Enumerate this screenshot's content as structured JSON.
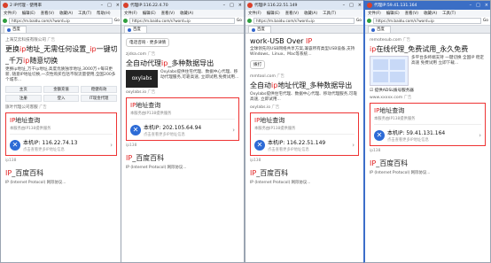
{
  "windows": [
    {
      "title": "2 IP代理 - 使用率",
      "menu": [
        "文件(F)",
        "编辑(E)",
        "查看(V)",
        "收藏(A)",
        "工具(T)",
        "帮助(H)"
      ],
      "address": "https://m.baidu.com/s?word=ip",
      "go": "Go",
      "tab": "百度",
      "lines": [
        {
          "type": "url",
          "text": "上海艾云科技有限公司",
          "badge": "广告"
        },
        {
          "type": "head",
          "pre": "更换",
          "red": "ip",
          "post": "地址_无需任何设置_",
          "red2": "ip",
          "post2": "一键切换"
        },
        {
          "type": "head2",
          "pre": "_千万",
          "red": "ip",
          "post": "随意切换"
        },
        {
          "type": "text",
          "text": "更换ip地址_万千ip地址,高度优质独享地址,3000万+每日更新, 随意IP地址切换,一次性购买包括不限流量使用,全国200多个城市..."
        },
        {
          "type": "buttons",
          "items": [
            "主页",
            "金额充值",
            "稳健有效",
            "注册",
            "登入",
            "IT现金代理"
          ]
        },
        {
          "type": "url",
          "text": "旗叶代理公司客服",
          "badge": "广告"
        }
      ],
      "box": {
        "title_red": "IP",
        "title": "地址查询",
        "sub": "本服务由IP138提供服务",
        "ip_label": "本机IP: ",
        "ip": "116.22.74.13",
        "ip_sub": "点击查看更多IP地址信息"
      },
      "foot": "ip138",
      "big_red": "IP",
      "big": "_百度百科",
      "mini": "IP (Internet Protocol) 网际协议..."
    },
    {
      "title": "代理IP:116.22.4.70",
      "menu": [
        "文件(F)",
        "编辑(E)",
        "查看(V)",
        "收藏(A)"
      ],
      "address": "https://m.baidu.com/s?word=ip",
      "go": "Go",
      "tab": "百度",
      "lines": [
        {
          "type": "pill",
          "text": "电话咨询 · 更多详情"
        },
        {
          "type": "url",
          "text": "zjdsa.com",
          "badge": "广告"
        },
        {
          "type": "head",
          "pre": "全自动代理",
          "red": "ip",
          "post": "_多种数据导出"
        },
        {
          "type": "logo",
          "logo": "oxylabs",
          "text": "Oxylabs提供住宅代理、数据中心代理、移动代理服务,可靠高速, 立即试用,免费试用..."
        },
        {
          "type": "url",
          "text": "oxylabs.io",
          "badge": "广告"
        }
      ],
      "box": {
        "title_red": "IP",
        "title": "地址查询",
        "sub": "本服务由IP138提供服务",
        "ip_label": "本机IP: ",
        "ip": "202.105.64.94",
        "ip_sub": "点击查看更多IP地址信息"
      },
      "foot": "ip138",
      "big_red": "IP",
      "big": "_百度百科",
      "mini": "IP (Internet Protocol) 网际协议..."
    },
    {
      "title": "代理IP:116.22.51.149",
      "menu": [
        "文件(F)",
        "编辑(E)",
        "查看(V)",
        "收藏(A)",
        "工具(T)"
      ],
      "address": "https://m.baidu.com/s?word=ip",
      "go": "Go",
      "tab": "百度",
      "lines": [
        {
          "type": "head",
          "pre": "work-USB Over ",
          "red": "IP",
          "post": ""
        },
        {
          "type": "text",
          "text": "全球领先的USB网络共享方案,兼容所有类型USB设备,支持Windows、Linux、Mac等系统..."
        },
        {
          "type": "pill",
          "text": "拨打"
        },
        {
          "type": "url",
          "text": "mmtool.com",
          "badge": "广告"
        },
        {
          "type": "head",
          "pre": "全自动",
          "red": "ip",
          "post": "地址代理_多种数据导出"
        },
        {
          "type": "text",
          "text": "Oxylabs提供住宅代理、数据中心代理、移动代理服务,可靠高速, 立即试用..."
        },
        {
          "type": "url",
          "text": "oxylabs.io",
          "badge": "广告"
        }
      ],
      "box": {
        "title_red": "IP",
        "title": "地址查询",
        "sub": "本服务由IP138提供服务",
        "ip_label": "本机IP: ",
        "ip": "116.22.51.149",
        "ip_sub": "点击查看更多IP地址信息"
      },
      "foot": "ip138",
      "big_red": "IP",
      "big": "_百度百科",
      "mini": "IP (Internet Protocol) 网际协议..."
    },
    {
      "title": "代理IP:59.41.131.164",
      "menu": [
        "文件(F)",
        "编辑(E)",
        "查看(V)",
        "收藏(A)",
        "工具(T)"
      ],
      "address": "https://m.baidu.com/s?word=ip",
      "go": "Go",
      "tab": "百度",
      "lines": [
        {
          "type": "url",
          "text": "remotesub.com",
          "badge": "广告"
        },
        {
          "type": "head",
          "pre": "",
          "red": "ip",
          "post": "在线代理_免费试用_永久免费"
        },
        {
          "type": "thumb",
          "text": "多平台多终端支持 一键切换 全国IP 稳定高速 免费试用 立即下载..."
        },
        {
          "type": "check",
          "text": "☑ 提供ADSL拨号服务器"
        },
        {
          "type": "url",
          "text": "www.xxxxx.com",
          "badge": "广告"
        }
      ],
      "box": {
        "title_red": "IP",
        "title": "地址查询",
        "sub": "本服务由IP138提供服务",
        "ip_label": "本机IP: ",
        "ip": "59.41.131.164",
        "ip_sub": "点击查看更多IP地址信息"
      },
      "foot": "ip138",
      "big_red": "IP",
      "big": "_百度百科",
      "mini": "IP (Internet Protocol) 网际协议..."
    }
  ]
}
